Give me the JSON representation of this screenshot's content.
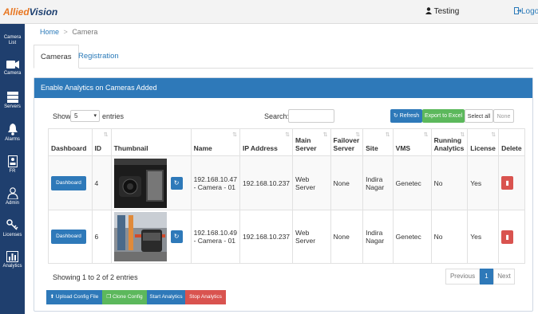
{
  "app": {
    "logo_part1": "Allied",
    "logo_part2": "Vision",
    "user_label": "Testing",
    "logout_label": "Logout"
  },
  "sidebar": {
    "items": [
      {
        "label": "Camera List",
        "icon": "camera-list-icon"
      },
      {
        "label": "Camera",
        "icon": "video-camera-icon"
      },
      {
        "label": "Servers",
        "icon": "server-icon"
      },
      {
        "label": "Alarms",
        "icon": "bell-icon"
      },
      {
        "label": "FR",
        "icon": "id-card-icon"
      },
      {
        "label": "Admin",
        "icon": "user-icon"
      },
      {
        "label": "Licenses",
        "icon": "keys-icon"
      },
      {
        "label": "Analytics",
        "icon": "bar-chart-icon"
      }
    ]
  },
  "breadcrumb": {
    "home": "Home",
    "sep": ">",
    "current": "Camera"
  },
  "tabs": [
    {
      "label": "Cameras"
    },
    {
      "label": "Registration"
    }
  ],
  "panel": {
    "title": "Enable Analytics on Cameras Added"
  },
  "controls": {
    "show_label": "Show",
    "show_value": "5",
    "entries_label": "entries",
    "search_label": "Search:",
    "refresh_label": "Refresh",
    "export_label": "Export to Excel",
    "select_all_label": "Select all",
    "none_label": "None"
  },
  "table": {
    "columns": [
      "Dashboard",
      "ID",
      "Thumbnail",
      "Name",
      "IP Address",
      "Main Server",
      "Failover Server",
      "Site",
      "VMS",
      "Running Analytics",
      "License",
      "Delete"
    ],
    "rows": [
      {
        "dashboard": "Dashboard",
        "id": "4",
        "name": "192.168.10.47 - Camera - 01",
        "ip": "192.168.10.237",
        "main_server": "Web Server",
        "failover": "None",
        "site": "Indira Nagar",
        "vms": "Genetec",
        "running": "No",
        "license": "Yes"
      },
      {
        "dashboard": "Dashboard",
        "id": "6",
        "name": "192.168.10.49 - Camera - 01",
        "ip": "192.168.10.237",
        "main_server": "Web Server",
        "failover": "None",
        "site": "Indira Nagar",
        "vms": "Genetec",
        "running": "No",
        "license": "Yes"
      }
    ]
  },
  "footer": {
    "info": "Showing 1 to 2 of 2 entries",
    "prev": "Previous",
    "page": "1",
    "next": "Next",
    "upload": "Upload Config File",
    "clone": "Clone Config",
    "start": "Start Analytics",
    "stop": "Stop Analytics"
  },
  "colors": {
    "brand_blue": "#2e79b9",
    "sidebar": "#1f3f6e",
    "green": "#5cb85c",
    "red": "#d9534f",
    "logo_orange": "#e87722"
  }
}
